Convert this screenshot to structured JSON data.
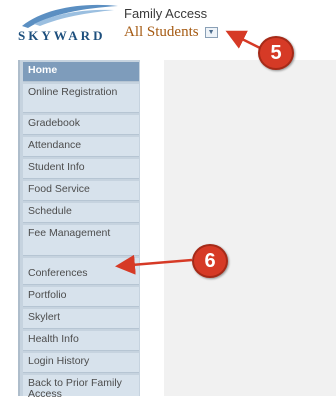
{
  "header": {
    "logo_text": "SKYWARD",
    "title": "Family Access",
    "student_selector": "All Students"
  },
  "callouts": {
    "first": "5",
    "second": "6"
  },
  "sidebar": {
    "items": [
      {
        "label": "Home",
        "active": true
      },
      {
        "label": "Online Registration"
      },
      {
        "label": "Gradebook"
      },
      {
        "label": "Attendance"
      },
      {
        "label": "Student Info"
      },
      {
        "label": "Food Service"
      },
      {
        "label": "Schedule"
      },
      {
        "label": "Fee Management"
      },
      {
        "label": "Conferences"
      },
      {
        "label": "Portfolio"
      },
      {
        "label": "Skylert"
      },
      {
        "label": "Health Info"
      },
      {
        "label": "Login History"
      },
      {
        "label": "Back to Prior Family Access"
      }
    ]
  },
  "colors": {
    "accent": "#7e9cbb",
    "callout": "#d63a26",
    "brand": "#1d4f7d"
  }
}
